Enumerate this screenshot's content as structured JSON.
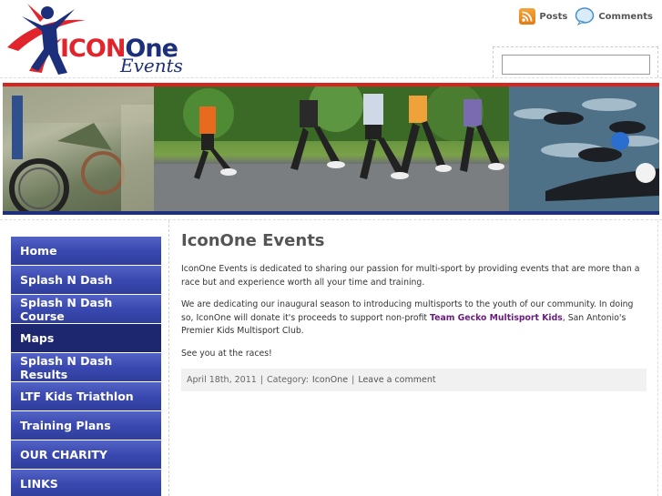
{
  "brand": {
    "logo_main_left": "ICON",
    "logo_main_right": "One",
    "logo_sub": "Events"
  },
  "feeds": {
    "posts_label": "Posts",
    "comments_label": "Comments"
  },
  "search": {
    "value": "",
    "placeholder": ""
  },
  "nav": {
    "items": [
      {
        "label": "Home"
      },
      {
        "label": "Splash N Dash"
      },
      {
        "label": "Splash N Dash Course"
      },
      {
        "label": "Maps"
      },
      {
        "label": "Splash N Dash Results"
      },
      {
        "label": "LTF Kids Triathlon"
      },
      {
        "label": "Training Plans"
      },
      {
        "label": "OUR CHARITY"
      },
      {
        "label": "LINKS"
      }
    ],
    "active_index": 3
  },
  "post": {
    "title": "IconOne Events",
    "p1": "IconOne Events is dedicated to sharing our passion for multi-sport by providing events that are more than a race but and experience worth all your time and training.",
    "p2_before": "We are dedicating our inaugural season to introducing multisports to the youth of our community.  In doing so, IconOne will donate it's proceeds to support non-profit ",
    "p2_link": "Team Gecko Multisport Kids",
    "p2_after": ", San Antonio's Premier Kids Multisport Club.",
    "p3": "See you at the races!",
    "meta_date": "April 18th, 2011",
    "meta_sep": "|",
    "meta_category_label": "Category:",
    "meta_category": "IconOne",
    "meta_comment": "Leave a comment"
  },
  "colors": {
    "brand_red": "#e0262c",
    "brand_blue": "#1b2f7a",
    "nav_blue": "#3a49b0",
    "nav_active": "#1d2770",
    "link_purple": "#6a1d7f"
  },
  "icons": [
    "rss-icon",
    "comments-icon",
    "logo-figure-icon"
  ]
}
